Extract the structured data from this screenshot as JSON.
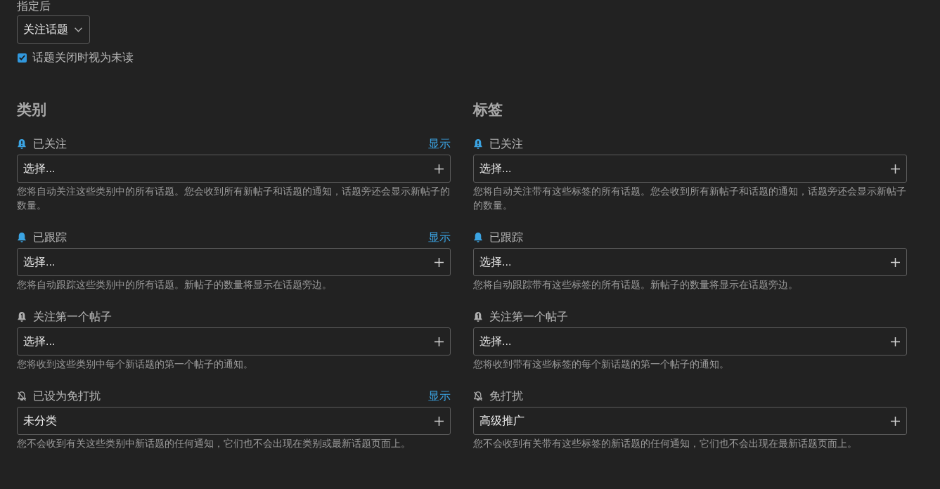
{
  "top": {
    "label": "指定后",
    "select": {
      "value": "关注话题"
    },
    "checkbox": {
      "label": "话题关闭时视为未读",
      "checked": true
    }
  },
  "columns": [
    {
      "title": "类别",
      "groups": [
        {
          "kind": "watching",
          "label": "已关注",
          "link": "显示",
          "field": {
            "placeholder": "选择..."
          },
          "description": "您将自动关注这些类别中的所有话题。您会收到所有新帖子和话题的通知，话题旁还会显示新帖子的数量。"
        },
        {
          "kind": "tracking",
          "label": "已跟踪",
          "link": "显示",
          "field": {
            "placeholder": "选择..."
          },
          "description": "您将自动跟踪这些类别中的所有话题。新帖子的数量将显示在话题旁边。"
        },
        {
          "kind": "watching_first_post",
          "label": "关注第一个帖子",
          "field": {
            "placeholder": "选择..."
          },
          "description": "您将收到这些类别中每个新话题的第一个帖子的通知。"
        },
        {
          "kind": "muted",
          "label": "已设为免打扰",
          "link": "显示",
          "field": {
            "value": "未分类"
          },
          "description": "您不会收到有关这些类别中新话题的任何通知，它们也不会出现在类别或最新话题页面上。"
        }
      ]
    },
    {
      "title": "标签",
      "groups": [
        {
          "kind": "watching",
          "label": "已关注",
          "field": {
            "placeholder": "选择..."
          },
          "description": "您将自动关注带有这些标签的所有话题。您会收到所有新帖子和话题的通知，话题旁还会显示新帖子的数量。"
        },
        {
          "kind": "tracking",
          "label": "已跟踪",
          "field": {
            "placeholder": "选择..."
          },
          "description": "您将自动跟踪带有这些标签的所有话题。新帖子的数量将显示在话题旁边。"
        },
        {
          "kind": "watching_first_post",
          "label": "关注第一个帖子",
          "field": {
            "placeholder": "选择..."
          },
          "description": "您将收到带有这些标签的每个新话题的第一个帖子的通知。"
        },
        {
          "kind": "muted",
          "label": "免打扰",
          "field": {
            "value": "高级推广"
          },
          "description": "您不会收到有关带有这些标签的新话题的任何通知，它们也不会出现在最新话题页面上。"
        }
      ]
    }
  ]
}
